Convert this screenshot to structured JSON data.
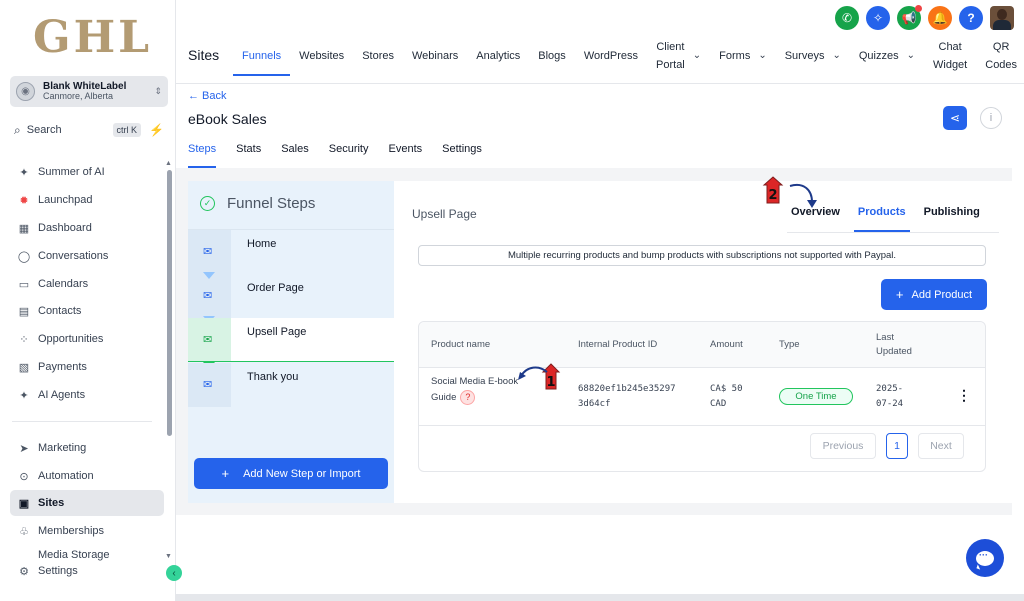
{
  "brand": {
    "logo_text": "GHL",
    "logo_color": "#b39b73",
    "accent": "#2563eb"
  },
  "account": {
    "name": "Blank WhiteLabel",
    "location": "Canmore, Alberta"
  },
  "search": {
    "label": "Search",
    "shortcut": "ctrl K"
  },
  "sidebar": {
    "items": [
      {
        "label": "Summer of AI",
        "icon": "sparkle-icon"
      },
      {
        "label": "Launchpad",
        "icon": "rocket-icon"
      },
      {
        "label": "Dashboard",
        "icon": "grid-icon"
      },
      {
        "label": "Conversations",
        "icon": "chat-icon"
      },
      {
        "label": "Calendars",
        "icon": "calendar-icon"
      },
      {
        "label": "Contacts",
        "icon": "contacts-icon"
      },
      {
        "label": "Opportunities",
        "icon": "opportunities-icon"
      },
      {
        "label": "Payments",
        "icon": "payments-icon"
      },
      {
        "label": "AI Agents",
        "icon": "sparkle-icon"
      }
    ],
    "items2": [
      {
        "label": "Marketing",
        "icon": "send-icon"
      },
      {
        "label": "Automation",
        "icon": "automation-icon"
      },
      {
        "label": "Sites",
        "icon": "sites-icon",
        "active": true
      },
      {
        "label": "Memberships",
        "icon": "award-icon"
      },
      {
        "label": "Media Storage",
        "icon": "media-icon"
      },
      {
        "label": "Settings",
        "icon": "gear-icon"
      }
    ]
  },
  "topbar": {
    "section": "Sites",
    "menu": [
      {
        "label": "Funnels",
        "active": true
      },
      {
        "label": "Websites"
      },
      {
        "label": "Stores"
      },
      {
        "label": "Webinars"
      },
      {
        "label": "Analytics"
      },
      {
        "label": "Blogs"
      },
      {
        "label": "WordPress"
      },
      {
        "label": "Client Portal",
        "line1": "Client",
        "line2": "Portal",
        "dropdown": true
      },
      {
        "label": "Forms",
        "dropdown": true
      },
      {
        "label": "Surveys",
        "dropdown": true
      },
      {
        "label": "Quizzes",
        "dropdown": true
      },
      {
        "label": "Chat Widget",
        "line1": "Chat",
        "line2": "Widget"
      },
      {
        "label": "QR Codes",
        "line1": "QR",
        "line2": "Codes"
      }
    ],
    "icons": [
      {
        "name": "phone-icon",
        "color": "#16a34a"
      },
      {
        "name": "magic-icon",
        "color": "#2563eb"
      },
      {
        "name": "megaphone-icon",
        "color": "#16a34a",
        "dot": true
      },
      {
        "name": "bell-icon",
        "color": "#f97316"
      },
      {
        "name": "help-icon",
        "color": "#2563eb"
      }
    ]
  },
  "funnel": {
    "back_label": "← Back",
    "title": "eBook Sales",
    "tabs": [
      "Steps",
      "Stats",
      "Sales",
      "Security",
      "Events",
      "Settings"
    ],
    "active_tab": "Steps"
  },
  "steps_panel": {
    "title": "Funnel Steps",
    "steps": [
      "Home",
      "Order Page",
      "Upsell Page",
      "Thank you"
    ],
    "selected": "Upsell Page",
    "add_button": "Add New Step or Import"
  },
  "page_panel": {
    "name": "Upsell Page",
    "tabs": [
      "Overview",
      "Products",
      "Publishing"
    ],
    "active_tab": "Products",
    "notice": "Multiple recurring products and bump products with subscriptions not supported with Paypal.",
    "add_button": "Add Product"
  },
  "table": {
    "headers": {
      "product_name": "Product name",
      "internal_id": "Internal Product ID",
      "amount": "Amount",
      "type": "Type",
      "last_updated_1": "Last",
      "last_updated_2": "Updated"
    },
    "rows": [
      {
        "name_line1": "Social Media E-book",
        "name_line2": "Guide",
        "id_line1": "68820ef1b245e35297",
        "id_line2": "3d64cf",
        "amount_line1": "CA$ 50",
        "amount_line2": "CAD",
        "type": "One Time",
        "date_line1": "2025-",
        "date_line2": "07-24"
      }
    ],
    "pagination": {
      "previous": "Previous",
      "current": "1",
      "next": "Next"
    }
  },
  "annotations": {
    "marker1": "1",
    "marker2": "2",
    "marker_color": "#dc2626",
    "arrow_color": "#1e3a8a"
  }
}
